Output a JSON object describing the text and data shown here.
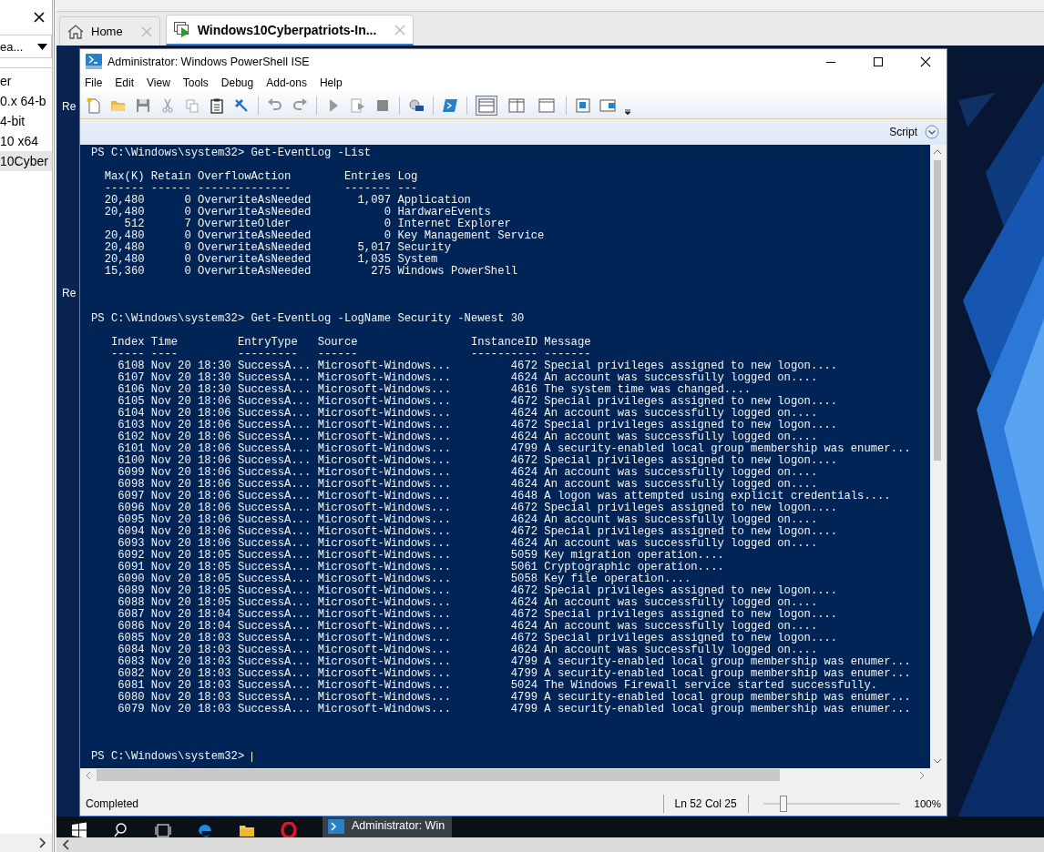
{
  "host": {
    "sidebar": {
      "search": {
        "value": "ea..."
      },
      "items": [
        {
          "label": "er",
          "selected": false
        },
        {
          "label": "0.x 64-b",
          "selected": false
        },
        {
          "label": "4-bit",
          "selected": false
        },
        {
          "label": "10 x64",
          "selected": false
        },
        {
          "label": "10Cyber",
          "selected": true
        }
      ]
    },
    "tabs": [
      {
        "kind": "home",
        "label": "Home",
        "selected": false
      },
      {
        "kind": "vm",
        "label": "Windows10Cyberpatriots-In...",
        "selected": true
      }
    ]
  },
  "desktop": {
    "icon_labels": [
      "Re",
      "Re"
    ]
  },
  "ise": {
    "title": "Administrator: Windows PowerShell ISE",
    "menu": [
      "File",
      "Edit",
      "View",
      "Tools",
      "Debug",
      "Add-ons",
      "Help"
    ],
    "layouts": [
      {
        "selected": true
      },
      {
        "selected": false
      },
      {
        "selected": false
      }
    ],
    "script_label": "Script",
    "console": {
      "lines": [
        {
          "kind": "prompt",
          "text": "PS C:\\Windows\\system32> Get-EventLog -List",
          "cursor": false
        },
        {
          "kind": "blank"
        },
        {
          "kind": "output",
          "text": "  Max(K) Retain OverflowAction        Entries Log"
        },
        {
          "kind": "output",
          "text": "  ------ ------ --------------        ------- ---"
        },
        {
          "kind": "output",
          "text": "  20,480      0 OverwriteAsNeeded       1,097 Application"
        },
        {
          "kind": "output",
          "text": "  20,480      0 OverwriteAsNeeded           0 HardwareEvents"
        },
        {
          "kind": "output",
          "text": "     512      7 OverwriteOlder              0 Internet Explorer"
        },
        {
          "kind": "output",
          "text": "  20,480      0 OverwriteAsNeeded           0 Key Management Service"
        },
        {
          "kind": "output",
          "text": "  20,480      0 OverwriteAsNeeded       5,017 Security"
        },
        {
          "kind": "output",
          "text": "  20,480      0 OverwriteAsNeeded       1,035 System"
        },
        {
          "kind": "output",
          "text": "  15,360      0 OverwriteAsNeeded         275 Windows PowerShell"
        },
        {
          "kind": "blank"
        },
        {
          "kind": "blank"
        },
        {
          "kind": "blank"
        },
        {
          "kind": "prompt",
          "text": "PS C:\\Windows\\system32> Get-EventLog -LogName Security -Newest 30",
          "cursor": false
        },
        {
          "kind": "blank"
        },
        {
          "kind": "output",
          "text": "   Index Time         EntryType   Source                 InstanceID Message"
        },
        {
          "kind": "output",
          "text": "   ----- ----         ---------   ------                 ---------- -------"
        },
        {
          "kind": "output",
          "text": "    6108 Nov 20 18:30 SuccessA... Microsoft-Windows...         4672 Special privileges assigned to new logon...."
        },
        {
          "kind": "output",
          "text": "    6107 Nov 20 18:30 SuccessA... Microsoft-Windows...         4624 An account was successfully logged on...."
        },
        {
          "kind": "output",
          "text": "    6106 Nov 20 18:30 SuccessA... Microsoft-Windows...         4616 The system time was changed...."
        },
        {
          "kind": "output",
          "text": "    6105 Nov 20 18:06 SuccessA... Microsoft-Windows...         4672 Special privileges assigned to new logon...."
        },
        {
          "kind": "output",
          "text": "    6104 Nov 20 18:06 SuccessA... Microsoft-Windows...         4624 An account was successfully logged on...."
        },
        {
          "kind": "output",
          "text": "    6103 Nov 20 18:06 SuccessA... Microsoft-Windows...         4672 Special privileges assigned to new logon...."
        },
        {
          "kind": "output",
          "text": "    6102 Nov 20 18:06 SuccessA... Microsoft-Windows...         4624 An account was successfully logged on...."
        },
        {
          "kind": "output",
          "text": "    6101 Nov 20 18:06 SuccessA... Microsoft-Windows...         4799 A security-enabled local group membership was enumer..."
        },
        {
          "kind": "output",
          "text": "    6100 Nov 20 18:06 SuccessA... Microsoft-Windows...         4672 Special privileges assigned to new logon...."
        },
        {
          "kind": "output",
          "text": "    6099 Nov 20 18:06 SuccessA... Microsoft-Windows...         4624 An account was successfully logged on...."
        },
        {
          "kind": "output",
          "text": "    6098 Nov 20 18:06 SuccessA... Microsoft-Windows...         4624 An account was successfully logged on...."
        },
        {
          "kind": "output",
          "text": "    6097 Nov 20 18:06 SuccessA... Microsoft-Windows...         4648 A logon was attempted using explicit credentials...."
        },
        {
          "kind": "output",
          "text": "    6096 Nov 20 18:06 SuccessA... Microsoft-Windows...         4672 Special privileges assigned to new logon...."
        },
        {
          "kind": "output",
          "text": "    6095 Nov 20 18:06 SuccessA... Microsoft-Windows...         4624 An account was successfully logged on...."
        },
        {
          "kind": "output",
          "text": "    6094 Nov 20 18:06 SuccessA... Microsoft-Windows...         4672 Special privileges assigned to new logon...."
        },
        {
          "kind": "output",
          "text": "    6093 Nov 20 18:06 SuccessA... Microsoft-Windows...         4624 An account was successfully logged on...."
        },
        {
          "kind": "output",
          "text": "    6092 Nov 20 18:05 SuccessA... Microsoft-Windows...         5059 Key migration operation...."
        },
        {
          "kind": "output",
          "text": "    6091 Nov 20 18:05 SuccessA... Microsoft-Windows...         5061 Cryptographic operation...."
        },
        {
          "kind": "output",
          "text": "    6090 Nov 20 18:05 SuccessA... Microsoft-Windows...         5058 Key file operation...."
        },
        {
          "kind": "output",
          "text": "    6089 Nov 20 18:05 SuccessA... Microsoft-Windows...         4672 Special privileges assigned to new logon...."
        },
        {
          "kind": "output",
          "text": "    6088 Nov 20 18:05 SuccessA... Microsoft-Windows...         4624 An account was successfully logged on...."
        },
        {
          "kind": "output",
          "text": "    6087 Nov 20 18:04 SuccessA... Microsoft-Windows...         4672 Special privileges assigned to new logon...."
        },
        {
          "kind": "output",
          "text": "    6086 Nov 20 18:04 SuccessA... Microsoft-Windows...         4624 An account was successfully logged on...."
        },
        {
          "kind": "output",
          "text": "    6085 Nov 20 18:03 SuccessA... Microsoft-Windows...         4672 Special privileges assigned to new logon...."
        },
        {
          "kind": "output",
          "text": "    6084 Nov 20 18:03 SuccessA... Microsoft-Windows...         4624 An account was successfully logged on...."
        },
        {
          "kind": "output",
          "text": "    6083 Nov 20 18:03 SuccessA... Microsoft-Windows...         4799 A security-enabled local group membership was enumer..."
        },
        {
          "kind": "output",
          "text": "    6082 Nov 20 18:03 SuccessA... Microsoft-Windows...         4799 A security-enabled local group membership was enumer..."
        },
        {
          "kind": "output",
          "text": "    6081 Nov 20 18:03 SuccessA... Microsoft-Windows...         5024 The Windows Firewall service started successfully."
        },
        {
          "kind": "output",
          "text": "    6080 Nov 20 18:03 SuccessA... Microsoft-Windows...         4799 A security-enabled local group membership was enumer..."
        },
        {
          "kind": "output",
          "text": "    6079 Nov 20 18:03 SuccessA... Microsoft-Windows...         4799 A security-enabled local group membership was enumer..."
        },
        {
          "kind": "blank"
        },
        {
          "kind": "blank"
        },
        {
          "kind": "blank"
        },
        {
          "kind": "prompt",
          "text": "PS C:\\Windows\\system32> ",
          "cursor": true
        }
      ]
    },
    "status": {
      "message": "Completed",
      "position": "Ln 52  Col 25",
      "zoom": "100%",
      "level": 0.15
    }
  },
  "taskbar": {
    "app": {
      "label": "Administrator: Win",
      "selected": true
    }
  }
}
